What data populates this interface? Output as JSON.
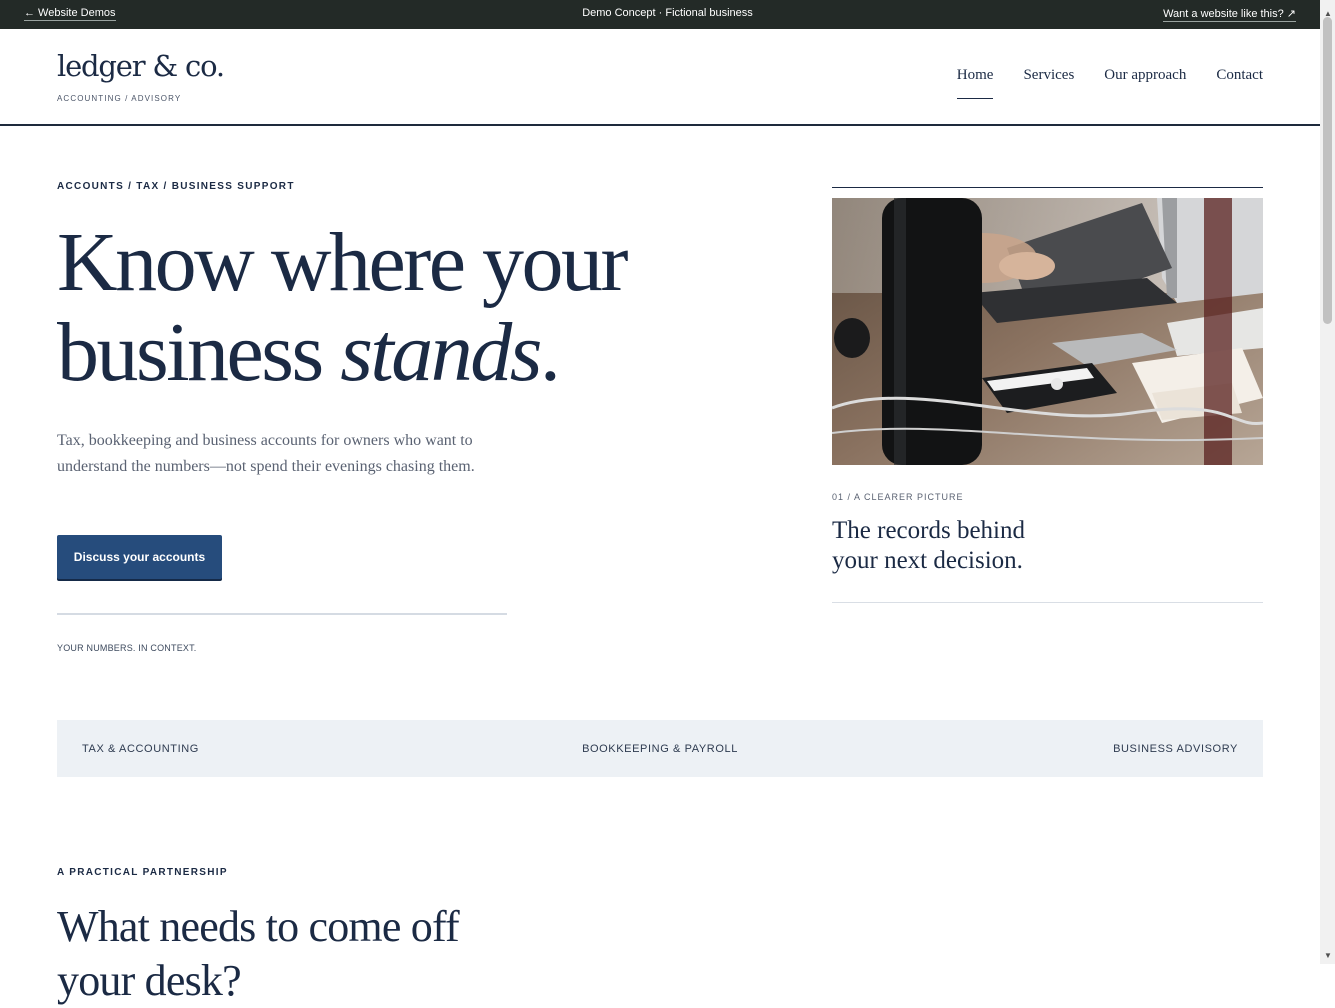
{
  "demo_bar": {
    "back_link": "← Website Demos",
    "center_text": "Demo Concept · Fictional business",
    "cta_link": "Want a website like this? ↗"
  },
  "header": {
    "logo": "ledger & co.",
    "logo_tagline": "ACCOUNTING / ADVISORY",
    "nav": [
      {
        "label": "Home",
        "active": true
      },
      {
        "label": "Services",
        "active": false
      },
      {
        "label": "Our approach",
        "active": false
      },
      {
        "label": "Contact",
        "active": false
      }
    ]
  },
  "hero": {
    "eyebrow": "ACCOUNTS / TAX / BUSINESS SUPPORT",
    "headline_line1": "Know where your",
    "headline_line2_start": "business ",
    "headline_line2_italic": "stands",
    "headline_line2_end": ".",
    "lead": "Tax, bookkeeping and business accounts for owners who want to understand the numbers—not spend their evenings chasing them.",
    "button_label": "Discuss your accounts",
    "caption": "YOUR NUMBERS. IN CONTEXT."
  },
  "feature_card": {
    "eyebrow": "01 / A CLEARER PICTURE",
    "title_line1": "The records behind",
    "title_line2": "your next decision.",
    "image_icon": "desk-calculator-laptop-photo"
  },
  "services_strip": [
    "TAX & ACCOUNTING",
    "BOOKKEEPING & PAYROLL",
    "BUSINESS ADVISORY"
  ],
  "section": {
    "eyebrow": "A PRACTICAL PARTNERSHIP",
    "title": "What needs to come off your desk?"
  },
  "colors": {
    "navy": "#1b2a44",
    "button": "#264c7c",
    "strip_bg": "#edf1f5",
    "demo_bar": "#232a27"
  }
}
